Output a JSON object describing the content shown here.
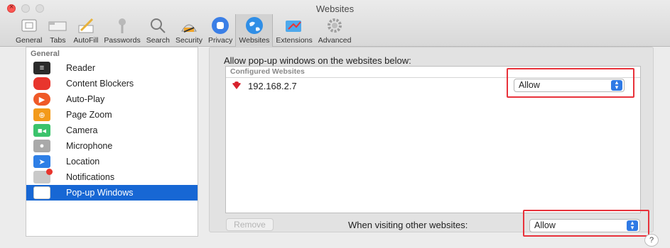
{
  "window": {
    "title": "Websites"
  },
  "toolbar": {
    "items": [
      {
        "label": "General",
        "icon": "general-icon"
      },
      {
        "label": "Tabs",
        "icon": "tabs-icon"
      },
      {
        "label": "AutoFill",
        "icon": "autofill-icon"
      },
      {
        "label": "Passwords",
        "icon": "key-icon"
      },
      {
        "label": "Search",
        "icon": "search-icon"
      },
      {
        "label": "Security",
        "icon": "security-icon"
      },
      {
        "label": "Privacy",
        "icon": "hand-icon"
      },
      {
        "label": "Websites",
        "icon": "globe-icon",
        "active": true
      },
      {
        "label": "Extensions",
        "icon": "puzzle-icon"
      },
      {
        "label": "Advanced",
        "icon": "gear-icon"
      }
    ]
  },
  "sidebar": {
    "header": "General",
    "items": [
      {
        "label": "Reader",
        "color": "#2b2b2b"
      },
      {
        "label": "Content Blockers",
        "color": "#e8352d"
      },
      {
        "label": "Auto-Play",
        "color": "#ef5a28"
      },
      {
        "label": "Page Zoom",
        "color": "#f39a1a"
      },
      {
        "label": "Camera",
        "color": "#3bc36b"
      },
      {
        "label": "Microphone",
        "color": "#a9a9a9"
      },
      {
        "label": "Location",
        "color": "#2e7fe6"
      },
      {
        "label": "Notifications",
        "color": "#c9c9c9"
      },
      {
        "label": "Pop-up Windows",
        "color": "#ffffff",
        "selected": true
      }
    ]
  },
  "panel": {
    "title": "Allow pop-up windows on the websites below:",
    "list_header": "Configured Websites",
    "sites": [
      {
        "name": "192.168.2.7",
        "setting": "Allow"
      }
    ],
    "remove_label": "Remove",
    "other_label": "When visiting other websites:",
    "other_setting": "Allow"
  },
  "help_label": "?"
}
